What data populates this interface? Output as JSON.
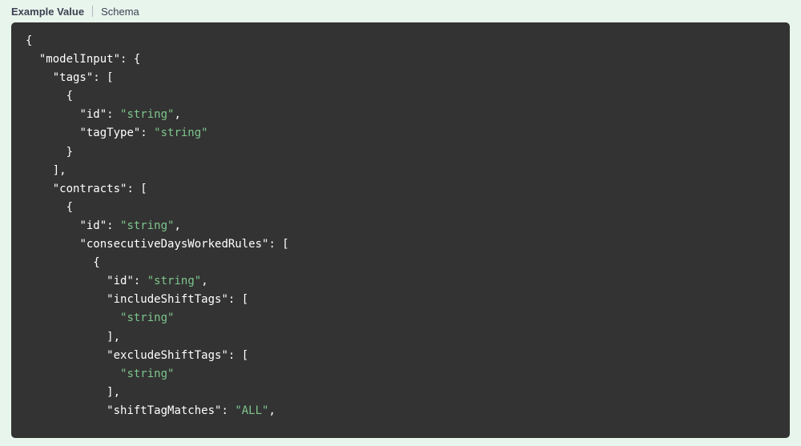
{
  "tabs": {
    "example_value": "Example Value",
    "schema": "Schema"
  },
  "code": {
    "string_placeholder": "string",
    "enum_all": "ALL",
    "json": {
      "modelInput": {
        "tags": [
          {
            "id": "string",
            "tagType": "string"
          }
        ],
        "contracts": [
          {
            "id": "string",
            "consecutiveDaysWorkedRules": [
              {
                "id": "string",
                "includeShiftTags": [
                  "string"
                ],
                "excludeShiftTags": [
                  "string"
                ],
                "shiftTagMatches": "ALL"
              }
            ]
          }
        ]
      }
    }
  }
}
